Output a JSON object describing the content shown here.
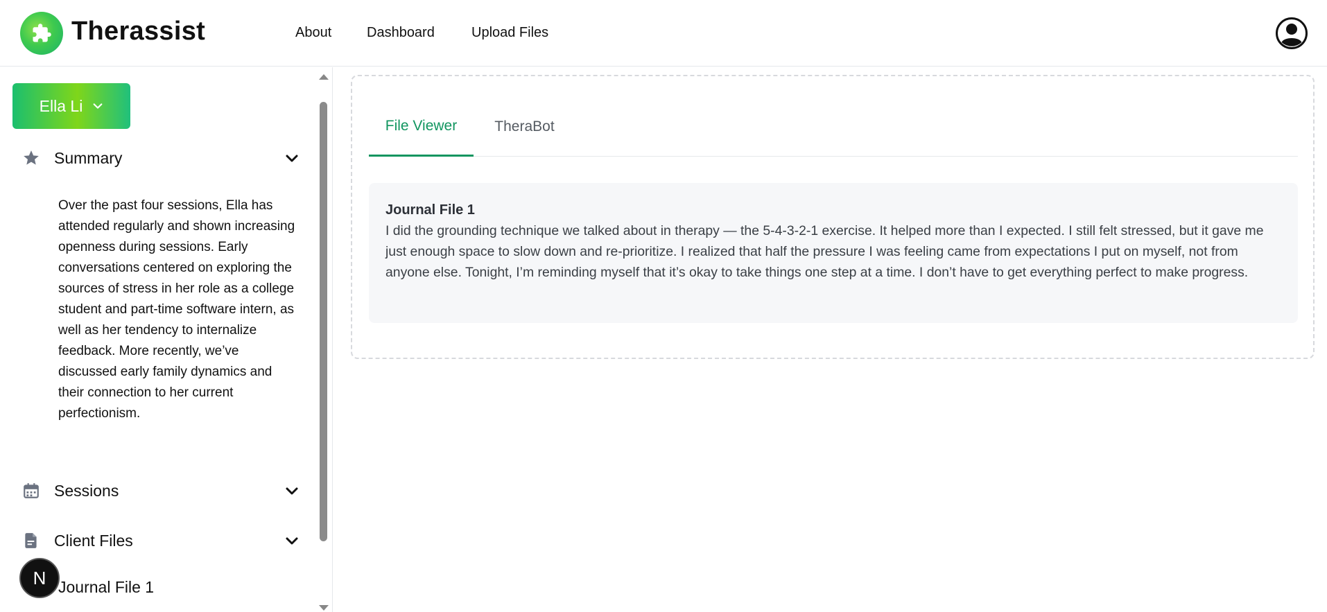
{
  "app": {
    "title": "Therassist"
  },
  "nav": {
    "items": [
      "About",
      "Dashboard",
      "Upload Files"
    ]
  },
  "sidebar": {
    "client_name": "Ella Li",
    "sections": {
      "summary": "Summary",
      "sessions": "Sessions",
      "client_files": "Client Files"
    },
    "summary_text": "Over the past four sessions, Ella has attended regularly and shown increasing openness during sessions. Early conversations centered on exploring the sources of stress in her role as a college student and part-time software intern, as well as her tendency to internalize feedback. More recently, we’ve discussed early family dynamics and their connection to her current perfectionism.",
    "files": [
      "Journal File 1"
    ]
  },
  "badge": {
    "letter": "N"
  },
  "main": {
    "tabs": [
      "File Viewer",
      "TheraBot"
    ],
    "active_tab": "File Viewer",
    "file": {
      "title": "Journal File 1",
      "body": "I did the grounding technique we talked about in therapy — the 5-4-3-2-1 exercise. It helped more than I expected. I still felt stressed, but it gave me just enough space to slow down and re-prioritize. I realized that half the pressure I was feeling came from expectations I put on myself, not from anyone else. Tonight, I’m reminding myself that it’s okay to take things one step at a time. I don’t have to get everything perfect to make progress."
    }
  },
  "colors": {
    "accent": "#11955f",
    "brand_gradient_start": "#1bbf6e",
    "brand_gradient_mid": "#7fd61a",
    "icon_gray": "#6b7280"
  },
  "icons": [
    "puzzle-icon",
    "user-circle-icon",
    "chevron-down-icon",
    "star-icon",
    "calendar-icon",
    "file-icon"
  ]
}
